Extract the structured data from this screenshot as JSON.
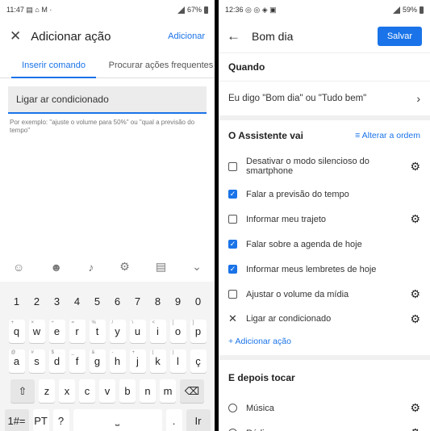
{
  "left": {
    "status_time": "11:47",
    "status_icons": "▤ ⌂ M ·",
    "status_battery": "67%",
    "title": "Adicionar ação",
    "add_label": "Adicionar",
    "tabs": [
      "Inserir comando",
      "Procurar ações frequentes"
    ],
    "command_value": "Ligar ar condicionado",
    "hint": "Por exemplo: \"ajuste o volume para 50%\" ou \"qual a previsão do tempo\"",
    "keyboard": {
      "row_numbers": [
        "1",
        "2",
        "3",
        "4",
        "5",
        "6",
        "7",
        "8",
        "9",
        "0"
      ],
      "row1": [
        [
          "q",
          "+"
        ],
        [
          "w",
          "×"
        ],
        [
          "e",
          "÷"
        ],
        [
          "r",
          "="
        ],
        [
          "t",
          "%"
        ],
        [
          "y",
          "/"
        ],
        [
          "u",
          "\\"
        ],
        [
          "i",
          "<"
        ],
        [
          "o",
          "["
        ],
        [
          "p",
          "]"
        ]
      ],
      "row2": [
        [
          "a",
          "@"
        ],
        [
          "s",
          "#"
        ],
        [
          "d",
          "$"
        ],
        [
          "f",
          "_"
        ],
        [
          "g",
          "&"
        ],
        [
          "h",
          "-"
        ],
        [
          "j",
          "+"
        ],
        [
          "k",
          "("
        ],
        [
          "l",
          ")"
        ],
        [
          "ç",
          ""
        ]
      ],
      "row3": [
        "z",
        "x",
        "c",
        "v",
        "b",
        "n",
        "m"
      ],
      "row4": {
        "sym": "1#=",
        "lang": "PT",
        "q": "?",
        "dot": ".",
        "ir": "Ir"
      }
    }
  },
  "right": {
    "status_time": "12:36",
    "status_icons": "◎ ◎ ◈ ▣",
    "status_battery": "59%",
    "title": "Bom dia",
    "save_label": "Salvar",
    "when_heading": "Quando",
    "trigger": "Eu digo \"Bom dia\" ou \"Tudo bem\"",
    "assistant_heading": "O Assistente vai",
    "reorder_label": "Alterar a ordem",
    "actions": [
      {
        "label": "Desativar o modo silencioso do smartphone",
        "checked": false,
        "settings": true
      },
      {
        "label": "Falar a previsão do tempo",
        "checked": true,
        "settings": false
      },
      {
        "label": "Informar meu trajeto",
        "checked": false,
        "settings": true
      },
      {
        "label": "Falar sobre a agenda de hoje",
        "checked": true,
        "settings": false
      },
      {
        "label": "Informar meus lembretes de hoje",
        "checked": true,
        "settings": false
      },
      {
        "label": "Ajustar o volume da mídia",
        "checked": false,
        "settings": true
      }
    ],
    "new_action": "Ligar ar condicionado",
    "add_action": "+ Adicionar ação",
    "then_heading": "E depois tocar",
    "media": [
      "Música",
      "Rádio"
    ]
  }
}
